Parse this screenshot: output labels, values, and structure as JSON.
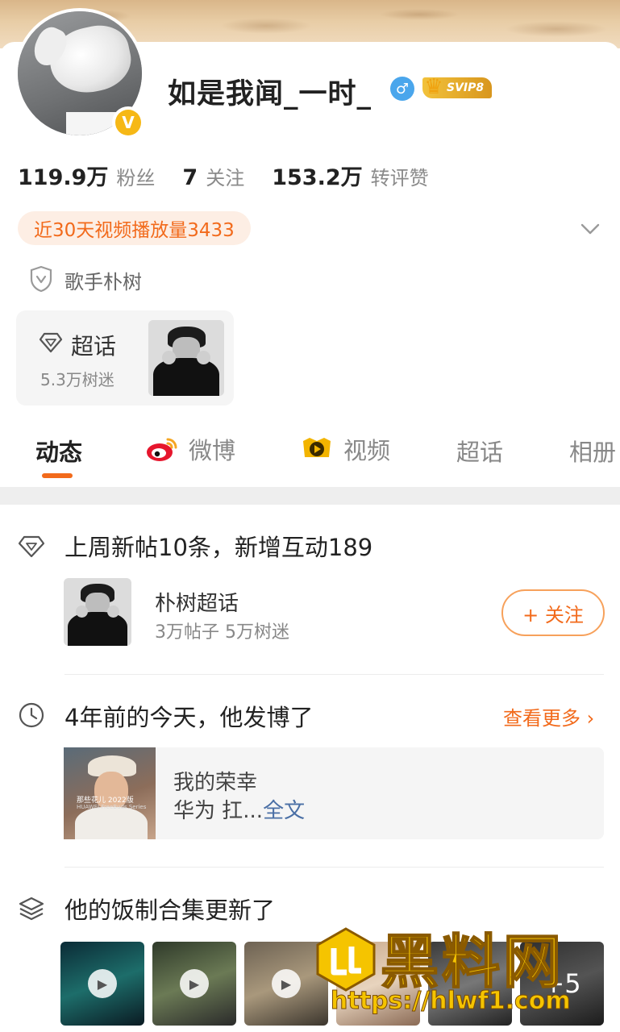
{
  "profile": {
    "username": "如是我闻_一时_",
    "gender_icon": "male-icon",
    "gender_symbol": "♂",
    "vip_badge": "SVIP8",
    "verify_symbol": "V"
  },
  "stats": {
    "fans_num": "119.9万",
    "fans_label": "粉丝",
    "following_num": "7",
    "following_label": "关注",
    "interactions_num": "153.2万",
    "interactions_label": "转评赞"
  },
  "play_count": "近30天视频播放量3433",
  "certification": "歌手朴树",
  "supertopic_card": {
    "title": "超话",
    "fans": "5.3万树迷"
  },
  "tabs": [
    {
      "label": "动态"
    },
    {
      "label": "微博"
    },
    {
      "label": "视频"
    },
    {
      "label": "超话"
    },
    {
      "label": "相册"
    }
  ],
  "feed": {
    "weekly": {
      "title": "上周新帖10条，新增互动189",
      "topic_name": "朴树超话",
      "topic_meta": "3万帖子 5万树迷",
      "follow_label": "+ 关注"
    },
    "memory": {
      "title": "4年前的今天，他发博了",
      "see_more": "查看更多",
      "line1": "我的荣幸",
      "line2_prefix": "华为 扛...",
      "full_text_link": "全文",
      "thumb_caption": "那些花儿 2022版",
      "thumb_caption2": "HUAWEI FreeBuds Series"
    },
    "collection": {
      "title": "他的饭制合集更新了",
      "more_count": "+5"
    }
  },
  "watermark": {
    "brand": "黑料网",
    "url": "https://hlwf1.com"
  },
  "colors": {
    "accent": "#f26a1b",
    "link": "#4a6fa5",
    "vip_gold": "#f2c23b",
    "verify_yellow": "#f6b816"
  }
}
